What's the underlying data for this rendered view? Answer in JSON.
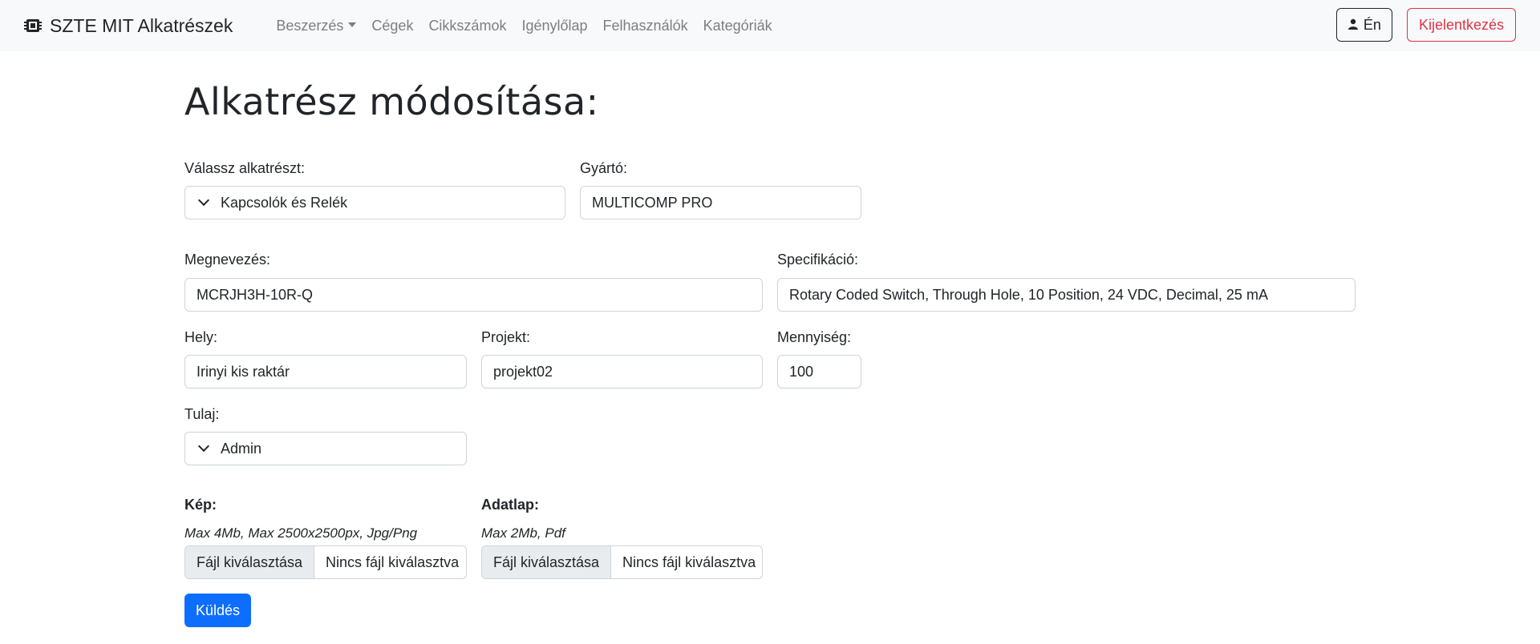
{
  "navbar": {
    "brand": "SZTE MIT Alkatrészek",
    "links": [
      "Beszerzés",
      "Cégek",
      "Cikkszámok",
      "Igénylőlap",
      "Felhasználók",
      "Kategóriák"
    ],
    "me_button": "Én",
    "logout_button": "Kijelentkezés",
    "logout_color": "#dc3545"
  },
  "page": {
    "title": "Alkatrész módosítása:"
  },
  "form": {
    "category": {
      "label": "Válassz alkatrészt:",
      "value": "Kapcsolók és Relék"
    },
    "manufacturer": {
      "label": "Gyártó:",
      "value": "MULTICOMP PRO"
    },
    "name": {
      "label": "Megnevezés:",
      "value": "MCRJH3H-10R-Q"
    },
    "spec": {
      "label": "Specifikáció:",
      "value": "Rotary Coded Switch, Through Hole, 10 Position, 24 VDC, Decimal, 25 mA"
    },
    "location": {
      "label": "Hely:",
      "value": "Irinyi kis raktár"
    },
    "project": {
      "label": "Projekt:",
      "value": "projekt02"
    },
    "quantity": {
      "label": "Mennyiség:",
      "value": "100"
    },
    "owner": {
      "label": "Tulaj:",
      "value": "Admin"
    },
    "image": {
      "label": "Kép:",
      "hint": "Max 4Mb, Max 2500x2500px, Jpg/Png",
      "button": "Fájl kiválasztása",
      "status": "Nincs fájl kiválasztva"
    },
    "datasheet": {
      "label": "Adatlap:",
      "hint": "Max 2Mb, Pdf",
      "button": "Fájl kiválasztása",
      "status": "Nincs fájl kiválasztva"
    },
    "submit": "Küldés",
    "submit_color": "#0d6efd"
  }
}
